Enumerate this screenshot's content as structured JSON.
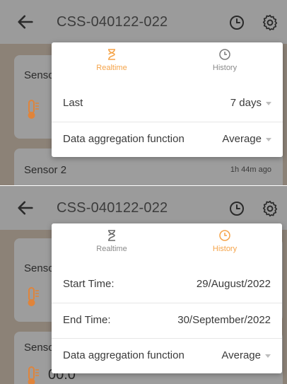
{
  "colors": {
    "accent": "#f5a44a",
    "appbar": "#9b9b9b",
    "text": "#3a3a3a"
  },
  "top": {
    "appbar": {
      "title": "CSS-040122-022",
      "icons": [
        "back-arrow-icon",
        "clock-icon",
        "gear-icon"
      ]
    },
    "background": {
      "card1_label": "Senso",
      "card2_label": "Sensor 2",
      "card2_time": "1h 44m ago"
    },
    "popup": {
      "tabs": [
        {
          "label": "Realtime",
          "icon": "hourglass-icon",
          "active": true
        },
        {
          "label": "History",
          "icon": "clock-icon",
          "active": false
        }
      ],
      "rows": [
        {
          "key": "Last",
          "value": "7 days",
          "dropdown": true
        },
        {
          "key": "Data aggregation function",
          "value": "Average",
          "dropdown": true
        }
      ]
    }
  },
  "bottom": {
    "appbar": {
      "title": "CSS-040122-022",
      "icons": [
        "back-arrow-icon",
        "clock-icon",
        "gear-icon"
      ]
    },
    "background": {
      "card1_label": "Senso",
      "card2_label": "Senso",
      "reading": "00.0°"
    },
    "popup": {
      "tabs": [
        {
          "label": "Realtime",
          "icon": "hourglass-icon",
          "active": false
        },
        {
          "label": "History",
          "icon": "clock-icon",
          "active": true
        }
      ],
      "rows": [
        {
          "key": "Start Time:",
          "value": "29/August/2022",
          "dropdown": false
        },
        {
          "key": "End Time:",
          "value": "30/September/2022",
          "dropdown": false
        },
        {
          "key": "Data aggregation function",
          "value": "Average",
          "dropdown": true
        }
      ]
    }
  }
}
